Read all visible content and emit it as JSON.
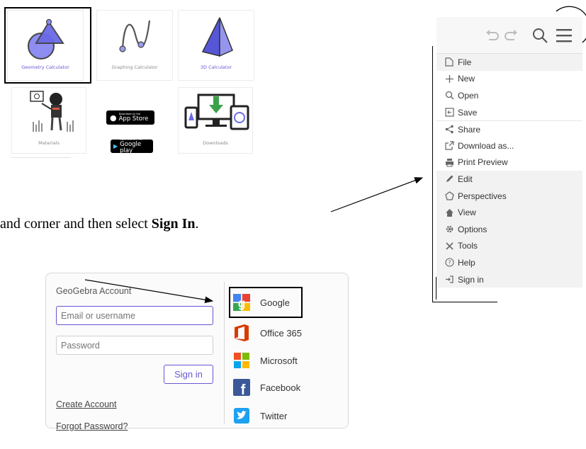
{
  "tiles": {
    "geometry": {
      "label": "Geometry Calculator"
    },
    "graphing": {
      "label": "Graphing Calculator"
    },
    "three_d": {
      "label": "3D Calculator"
    },
    "materials": {
      "label": "Materials"
    },
    "downloads": {
      "label": "Downloads"
    },
    "app_store": {
      "small": "Download on the",
      "big": "App Store"
    },
    "google_play": {
      "small": "ANDROID APP ON",
      "big": "Google play"
    }
  },
  "instruction": {
    "before": "and corner and then select ",
    "bold": "Sign In",
    "after": "."
  },
  "menu": {
    "toolbar_icons": [
      "undo-icon",
      "redo-icon",
      "search-icon",
      "hamburger-menu-icon"
    ],
    "items": [
      {
        "label": "File",
        "icon": "file-icon"
      },
      {
        "label": "New",
        "icon": "plus-icon"
      },
      {
        "label": "Open",
        "icon": "search-icon"
      },
      {
        "label": "Save",
        "icon": "save-icon"
      },
      {
        "label": "Share",
        "icon": "share-icon"
      },
      {
        "label": "Download as...",
        "icon": "export-icon"
      },
      {
        "label": "Print Preview",
        "icon": "print-icon"
      },
      {
        "label": "Edit",
        "icon": "pencil-icon"
      },
      {
        "label": "Perspectives",
        "icon": "pentagon-icon"
      },
      {
        "label": "View",
        "icon": "home-icon"
      },
      {
        "label": "Options",
        "icon": "gear-icon"
      },
      {
        "label": "Tools",
        "icon": "tools-icon"
      },
      {
        "label": "Help",
        "icon": "help-icon"
      },
      {
        "label": "Sign in",
        "icon": "sign-in-icon"
      }
    ]
  },
  "login": {
    "title": "GeoGebra Account",
    "email_placeholder": "Email or username",
    "password_placeholder": "Password",
    "signin_label": "Sign in",
    "create_account": "Create Account",
    "forgot_password": "Forgot Password?",
    "providers": [
      "Google",
      "Office 365",
      "Microsoft",
      "Facebook",
      "Twitter"
    ]
  },
  "colors": {
    "accent": "#6557d2",
    "menu_header": "#f2f2f2",
    "google_blue": "#4285f4",
    "office_orange": "#d83b01",
    "facebook_blue": "#3b5998",
    "twitter_blue": "#1da1f2"
  }
}
